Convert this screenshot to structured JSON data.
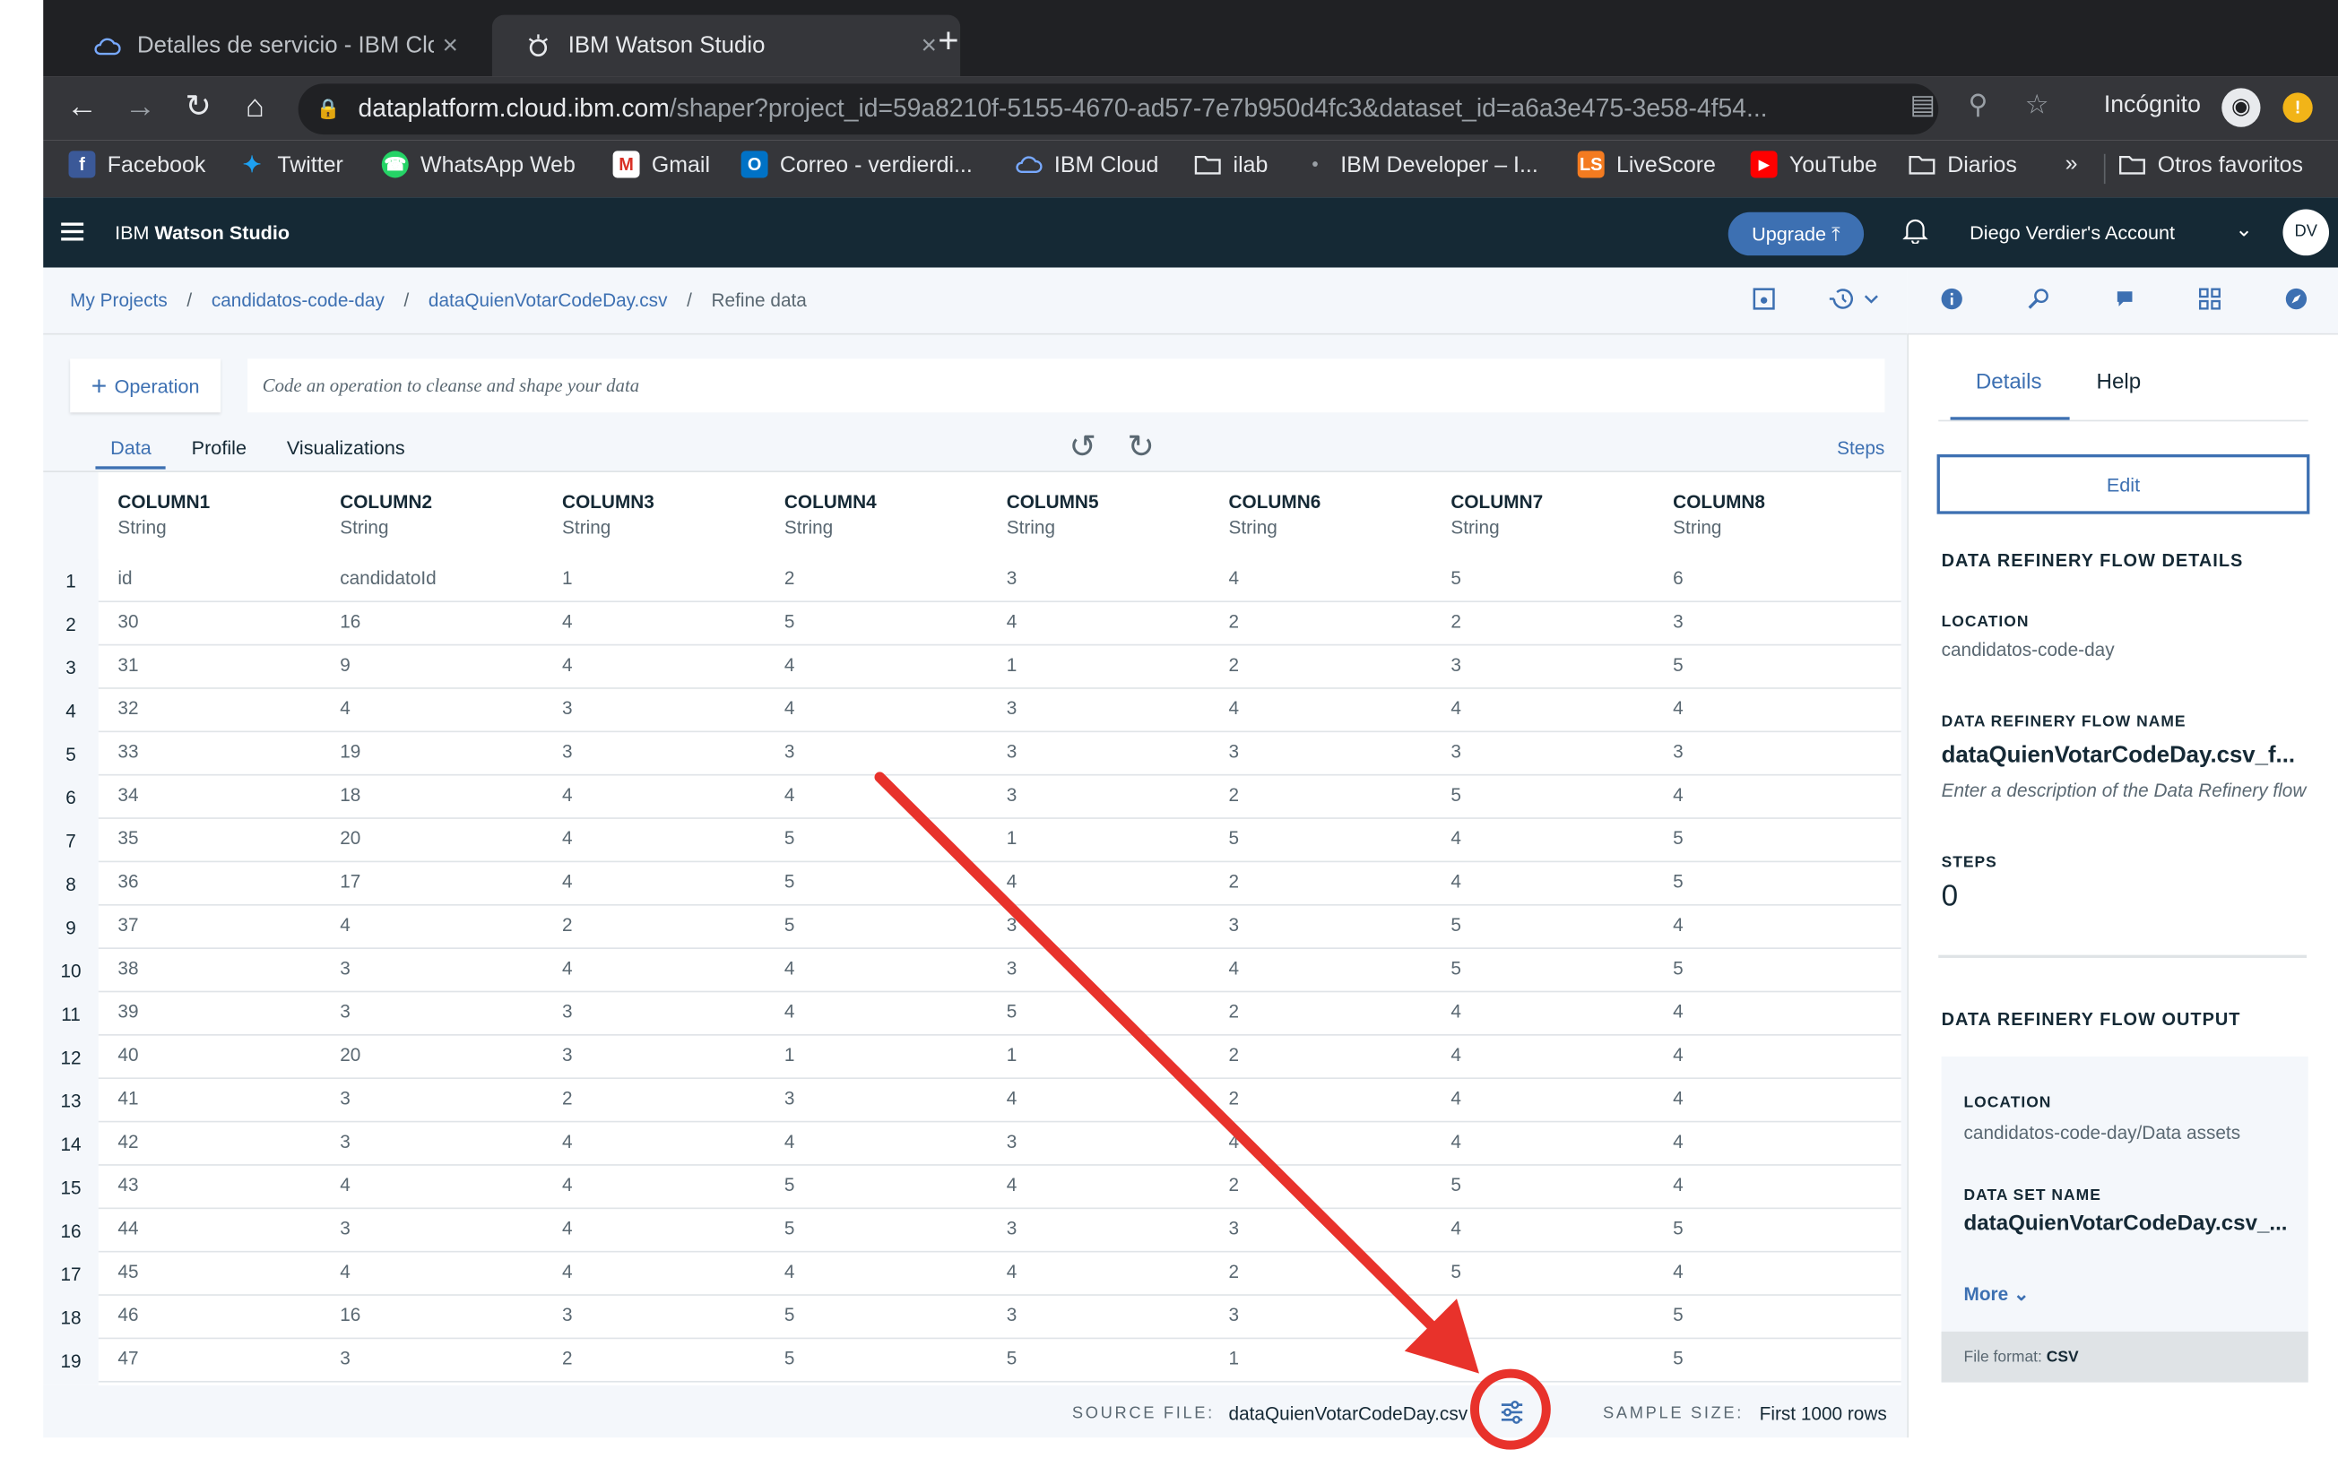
{
  "browser": {
    "tabs": [
      {
        "title": "Detalles de servicio - IBM Clou",
        "close": "×"
      },
      {
        "title": "IBM Watson Studio",
        "close": "×"
      }
    ],
    "new_tab": "+",
    "url_host": "dataplatform.cloud.ibm.com",
    "url_path": "/shaper?project_id=59a8210f-5155-4670-ad57-7e7b950d4fc3&dataset_id=a6a3e475-3e58-4f54...",
    "incognito_label": "Incógnito",
    "bookmarks": [
      {
        "label": "Facebook",
        "icon": "facebook-icon",
        "color": "#3b5998"
      },
      {
        "label": "Twitter",
        "icon": "twitter-icon",
        "color": "#1da1f2"
      },
      {
        "label": "WhatsApp Web",
        "icon": "whatsapp-icon",
        "color": "#25d366"
      },
      {
        "label": "Gmail",
        "icon": "gmail-icon",
        "color": "#d93025"
      },
      {
        "label": "Correo - verdierdi...",
        "icon": "outlook-icon",
        "color": "#0072c6"
      },
      {
        "label": "IBM Cloud",
        "icon": "ibm-cloud-icon",
        "color": "#4178be"
      },
      {
        "label": "ilab",
        "icon": "folder-icon",
        "color": "#e8eaed"
      },
      {
        "label": "IBM Developer – I...",
        "icon": "ibm-developer-icon",
        "color": "#202124"
      },
      {
        "label": "LiveScore",
        "icon": "livescore-icon",
        "color": "#f47b20"
      },
      {
        "label": "YouTube",
        "icon": "youtube-icon",
        "color": "#ff0000"
      },
      {
        "label": "Diarios",
        "icon": "folder-icon",
        "color": "#e8eaed"
      }
    ],
    "bookmarks_more": "»",
    "other_bookmarks": "Otros favoritos"
  },
  "header": {
    "brand_prefix": "IBM ",
    "brand_bold": "Watson Studio",
    "upgrade_label": "Upgrade",
    "account": "Diego Verdier's Account",
    "avatar": "DV"
  },
  "breadcrumb": {
    "items": [
      "My Projects",
      "candidatos-code-day",
      "dataQuienVotarCodeDay.csv"
    ],
    "current": "Refine data",
    "separator": "/"
  },
  "toolbar": {
    "operation_label": "Operation",
    "code_placeholder": "Code an operation to cleanse and shape your data",
    "tabs": [
      "Data",
      "Profile",
      "Visualizations"
    ],
    "active_tab": "Data",
    "steps_label": "Steps"
  },
  "table": {
    "columns": [
      {
        "name": "COLUMN1",
        "type": "String"
      },
      {
        "name": "COLUMN2",
        "type": "String"
      },
      {
        "name": "COLUMN3",
        "type": "String"
      },
      {
        "name": "COLUMN4",
        "type": "String"
      },
      {
        "name": "COLUMN5",
        "type": "String"
      },
      {
        "name": "COLUMN6",
        "type": "String"
      },
      {
        "name": "COLUMN7",
        "type": "String"
      },
      {
        "name": "COLUMN8",
        "type": "String"
      }
    ],
    "rows": [
      [
        "1",
        "id",
        "candidatoId",
        "1",
        "2",
        "3",
        "4",
        "5",
        "6"
      ],
      [
        "2",
        "30",
        "16",
        "4",
        "5",
        "4",
        "2",
        "2",
        "3"
      ],
      [
        "3",
        "31",
        "9",
        "4",
        "4",
        "1",
        "2",
        "3",
        "5"
      ],
      [
        "4",
        "32",
        "4",
        "3",
        "4",
        "3",
        "4",
        "4",
        "4"
      ],
      [
        "5",
        "33",
        "19",
        "3",
        "3",
        "3",
        "3",
        "3",
        "3"
      ],
      [
        "6",
        "34",
        "18",
        "4",
        "4",
        "3",
        "2",
        "5",
        "4"
      ],
      [
        "7",
        "35",
        "20",
        "4",
        "5",
        "1",
        "5",
        "4",
        "5"
      ],
      [
        "8",
        "36",
        "17",
        "4",
        "5",
        "4",
        "2",
        "4",
        "5"
      ],
      [
        "9",
        "37",
        "4",
        "2",
        "5",
        "3",
        "3",
        "5",
        "4"
      ],
      [
        "10",
        "38",
        "3",
        "4",
        "4",
        "3",
        "4",
        "5",
        "5"
      ],
      [
        "11",
        "39",
        "3",
        "3",
        "4",
        "5",
        "2",
        "4",
        "4"
      ],
      [
        "12",
        "40",
        "20",
        "3",
        "1",
        "1",
        "2",
        "4",
        "4"
      ],
      [
        "13",
        "41",
        "3",
        "2",
        "3",
        "4",
        "2",
        "4",
        "4"
      ],
      [
        "14",
        "42",
        "3",
        "4",
        "4",
        "3",
        "4",
        "4",
        "4"
      ],
      [
        "15",
        "43",
        "4",
        "4",
        "5",
        "4",
        "2",
        "5",
        "4"
      ],
      [
        "16",
        "44",
        "3",
        "4",
        "5",
        "3",
        "3",
        "4",
        "5"
      ],
      [
        "17",
        "45",
        "4",
        "4",
        "4",
        "4",
        "2",
        "5",
        "4"
      ],
      [
        "18",
        "46",
        "16",
        "3",
        "5",
        "3",
        "3",
        "5",
        "5"
      ],
      [
        "19",
        "47",
        "3",
        "2",
        "5",
        "5",
        "1",
        "5",
        "5"
      ]
    ]
  },
  "footer": {
    "source_label": "SOURCE FILE:",
    "source_value": "dataQuienVotarCodeDay.csv",
    "sample_label": "SAMPLE SIZE:",
    "sample_value": "First 1000 rows"
  },
  "details": {
    "tabs": [
      "Details",
      "Help"
    ],
    "active_tab": "Details",
    "edit_label": "Edit",
    "flow_details_heading": "DATA REFINERY FLOW DETAILS",
    "location_label": "LOCATION",
    "location_value": "candidatos-code-day",
    "flow_name_label": "DATA REFINERY FLOW NAME",
    "flow_name_value": "dataQuienVotarCodeDay.csv_f...",
    "description_placeholder": "Enter a description of the Data Refinery flow",
    "steps_label": "STEPS",
    "steps_value": "0",
    "output_heading": "DATA REFINERY FLOW OUTPUT",
    "output_location_label": "LOCATION",
    "output_location_value": "candidatos-code-day/Data assets",
    "dataset_name_label": "DATA SET NAME",
    "dataset_name_value": "dataQuienVotarCodeDay.csv_...",
    "more_label": "More",
    "file_format_label": "File format:",
    "file_format_value": "CSV"
  },
  "colors": {
    "accent": "#3d70b2",
    "header_bg": "#152935",
    "annotation": "#e8322b"
  }
}
